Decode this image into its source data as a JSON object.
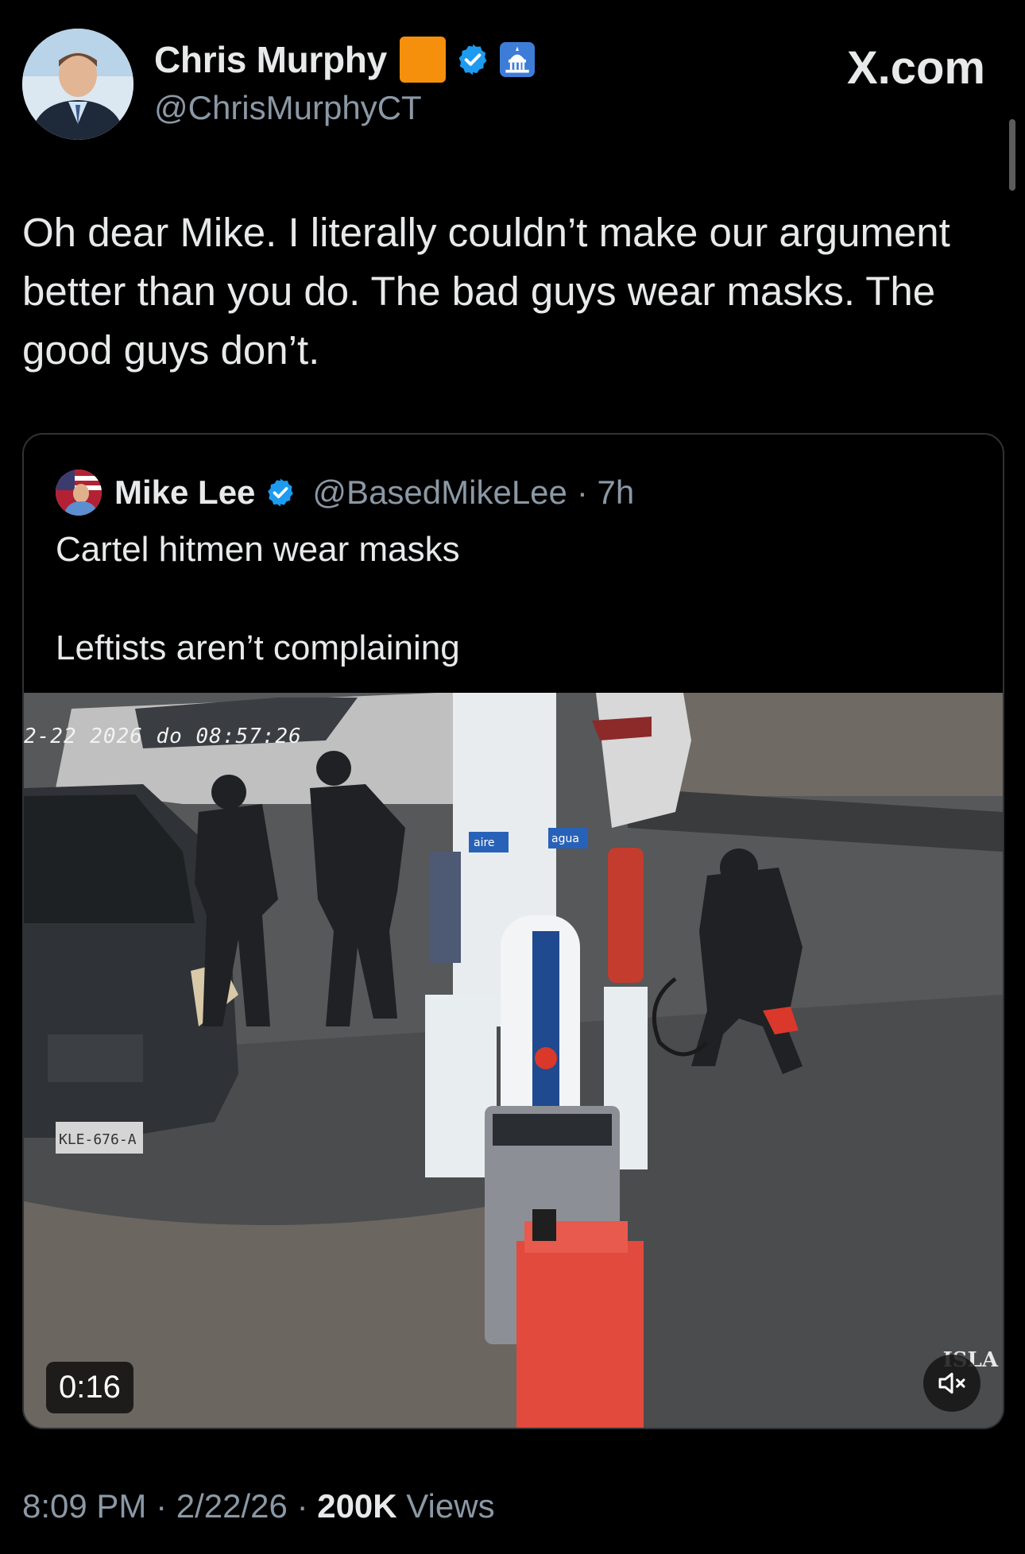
{
  "author": {
    "display_name": "Chris Murphy",
    "handle": "@ChrisMurphyCT",
    "icons": [
      "orange-square-emoji",
      "verified-badge-icon",
      "government-capitol-icon"
    ]
  },
  "brand": {
    "label": "X.com"
  },
  "tweet": {
    "text": "Oh dear Mike. I literally couldn’t make our argument better than you do. The bad guys wear masks. The good guys don’t."
  },
  "quote": {
    "display_name": "Mike Lee",
    "handle": "@BasedMikeLee",
    "time": "· 7h",
    "line1": "Cartel hitmen wear masks",
    "line2": "Leftists aren’t complaining",
    "video": {
      "duration": "0:16",
      "timestamp_overlay": "2-22 2026 do 08:57:26",
      "camera_brand": "ISLA",
      "pump_labels": [
        "aire",
        "agua"
      ],
      "license_plate": "KLE-676-A",
      "muted": true
    }
  },
  "meta": {
    "time": "8:09 PM",
    "date": "2/22/26",
    "views_count": "200K",
    "views_label": "Views"
  },
  "colors": {
    "background": "#000000",
    "text": "#e7e9ea",
    "muted_text": "#8b98a5",
    "verified_blue": "#1d9bf0",
    "border": "#2f3336"
  }
}
